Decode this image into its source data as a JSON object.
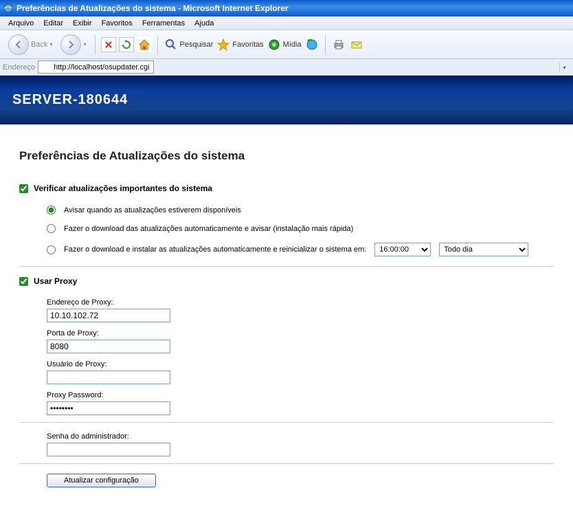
{
  "window": {
    "title": "Preferências de Atualizações do sistema - Microsoft Internet Explorer"
  },
  "menu": {
    "items": [
      "Arquivo",
      "Editar",
      "Exibir",
      "Favoritos",
      "Ferramentas",
      "Ajuda"
    ]
  },
  "toolbar": {
    "back": "Back",
    "search": "Pesquisar",
    "favorites": "Favoritas",
    "media": "Mídia"
  },
  "address": {
    "label": "Endereço",
    "url": "http://localhost/osupdater.cgi"
  },
  "banner": {
    "server_name": "SERVER-180644"
  },
  "page": {
    "heading": "Preferências de Atualizações do sistema",
    "check_updates": {
      "checked": true,
      "label": "Verificar atualizações importantes do sistema"
    },
    "radios": {
      "selected": 0,
      "option1": "Avisar quando as atualizações estiverem disponíveis",
      "option2": "Fazer o download das atualizações automaticamente e avisar (instalação mais rápida)",
      "option3_prefix": "Fazer o download e instalar as atualizações automaticamente e reinicializar o sistema em:",
      "time_value": "16:00:00",
      "day_value": "Todo dia"
    },
    "proxy": {
      "use_proxy_label": "Usar Proxy",
      "use_proxy_checked": true,
      "address_label": "Endereço de Proxy:",
      "address_value": "10.10.102.72",
      "port_label": "Porta de Proxy:",
      "port_value": "8080",
      "user_label": "Usuário de Proxy:",
      "user_value": "",
      "password_label": "Proxy Password:",
      "password_value": "••••••••"
    },
    "admin_pw_label": "Senha do administrador:",
    "admin_pw_value": "",
    "submit": "Atualizar configuração"
  }
}
